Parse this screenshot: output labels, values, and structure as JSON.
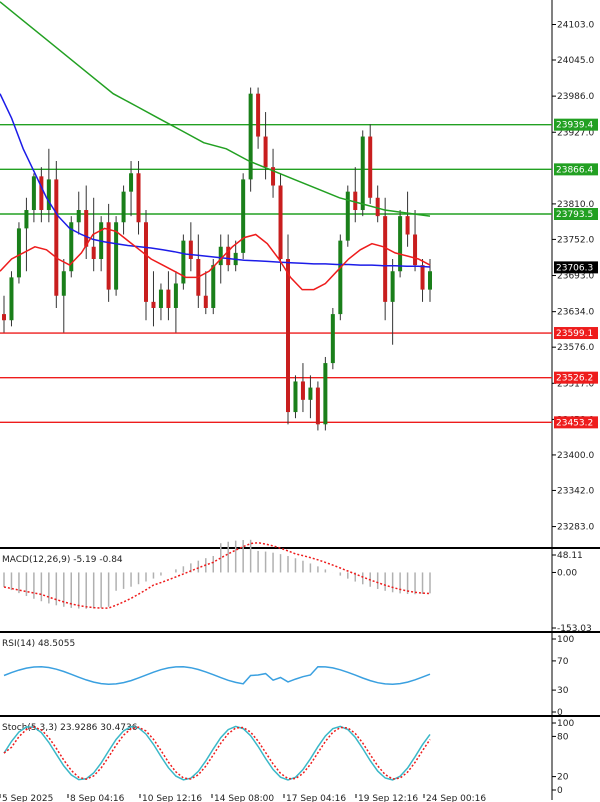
{
  "colors": {
    "up": "#1a7f1a",
    "down": "#c81e1e",
    "ma_fast": "#ee1c1c",
    "ma_mid": "#1c1ce8",
    "ma_slow": "#22a022",
    "resistance": "#22a022",
    "support": "#ee1c1c",
    "macd_hist": "#b0b0b0",
    "signal": "#ee1c1c",
    "rsi": "#3aa0e0",
    "stoch_main": "#3ab8c8",
    "stoch_signal": "#ee1c1c",
    "grid": "#cfcfcf",
    "price_tag": "#000000"
  },
  "chart_data": [
    {
      "type": "candlestick",
      "y_ticks": [
        "24103.0",
        "24045.0",
        "23986.0",
        "23927.0",
        "23810.0",
        "23752.0",
        "23693.0",
        "23634.0",
        "23576.0",
        "23517.0",
        "23458.0",
        "23400.0",
        "23342.0",
        "23283.0"
      ],
      "ylim": [
        23248,
        24143
      ],
      "last_price": "23706.3",
      "levels": [
        {
          "value": "23939.4",
          "kind": "resistance"
        },
        {
          "value": "23866.4",
          "kind": "resistance"
        },
        {
          "value": "23793.5",
          "kind": "resistance"
        },
        {
          "value": "23599.1",
          "kind": "support"
        },
        {
          "value": "23526.2",
          "kind": "support"
        },
        {
          "value": "23453.2",
          "kind": "support"
        }
      ],
      "x_labels": [
        "5 Sep 2025",
        "8 Sep 04:16",
        "10 Sep 12:16",
        "14 Sep 08:00",
        "17 Sep 04:16",
        "19 Sep 12:16",
        "24 Sep 00:16"
      ],
      "candles": [
        [
          23630,
          23660,
          23600,
          23620
        ],
        [
          23620,
          23700,
          23610,
          23690
        ],
        [
          23690,
          23780,
          23680,
          23770
        ],
        [
          23770,
          23820,
          23700,
          23800
        ],
        [
          23800,
          23860,
          23780,
          23855
        ],
        [
          23855,
          23870,
          23780,
          23800
        ],
        [
          23800,
          23900,
          23780,
          23850
        ],
        [
          23850,
          23880,
          23640,
          23660
        ],
        [
          23660,
          23720,
          23600,
          23700
        ],
        [
          23700,
          23790,
          23690,
          23780
        ],
        [
          23780,
          23830,
          23760,
          23800
        ],
        [
          23800,
          23840,
          23720,
          23740
        ],
        [
          23740,
          23820,
          23700,
          23720
        ],
        [
          23720,
          23790,
          23700,
          23780
        ],
        [
          23780,
          23810,
          23650,
          23670
        ],
        [
          23670,
          23790,
          23660,
          23780
        ],
        [
          23780,
          23840,
          23760,
          23830
        ],
        [
          23830,
          23880,
          23790,
          23860
        ],
        [
          23860,
          23880,
          23760,
          23780
        ],
        [
          23780,
          23800,
          23620,
          23650
        ],
        [
          23650,
          23700,
          23610,
          23640
        ],
        [
          23640,
          23680,
          23620,
          23670
        ],
        [
          23670,
          23700,
          23620,
          23640
        ],
        [
          23640,
          23700,
          23600,
          23680
        ],
        [
          23680,
          23760,
          23670,
          23750
        ],
        [
          23750,
          23780,
          23700,
          23720
        ],
        [
          23720,
          23760,
          23640,
          23660
        ],
        [
          23660,
          23700,
          23630,
          23640
        ],
        [
          23640,
          23720,
          23630,
          23710
        ],
        [
          23710,
          23760,
          23680,
          23740
        ],
        [
          23740,
          23760,
          23700,
          23710
        ],
        [
          23710,
          23750,
          23700,
          23730
        ],
        [
          23730,
          23860,
          23720,
          23850
        ],
        [
          23850,
          24000,
          23830,
          23990
        ],
        [
          23990,
          24000,
          23900,
          23920
        ],
        [
          23920,
          23960,
          23850,
          23870
        ],
        [
          23870,
          23900,
          23820,
          23840
        ],
        [
          23840,
          23860,
          23700,
          23720
        ],
        [
          23720,
          23760,
          23450,
          23470
        ],
        [
          23470,
          23530,
          23460,
          23520
        ],
        [
          23520,
          23550,
          23470,
          23490
        ],
        [
          23490,
          23530,
          23460,
          23510
        ],
        [
          23510,
          23520,
          23440,
          23450
        ],
        [
          23450,
          23560,
          23440,
          23550
        ],
        [
          23550,
          23640,
          23540,
          23630
        ],
        [
          23630,
          23760,
          23620,
          23750
        ],
        [
          23750,
          23840,
          23740,
          23830
        ],
        [
          23830,
          23870,
          23780,
          23800
        ],
        [
          23800,
          23930,
          23790,
          23920
        ],
        [
          23920,
          23940,
          23810,
          23820
        ],
        [
          23820,
          23840,
          23780,
          23790
        ],
        [
          23790,
          23820,
          23620,
          23650
        ],
        [
          23650,
          23720,
          23580,
          23700
        ],
        [
          23700,
          23800,
          23690,
          23790
        ],
        [
          23790,
          23830,
          23740,
          23760
        ],
        [
          23760,
          23800,
          23700,
          23710
        ],
        [
          23710,
          23720,
          23650,
          23670
        ],
        [
          23670,
          23720,
          23650,
          23700
        ]
      ],
      "ma_fast": [
        23700,
        23720,
        23730,
        23740,
        23735,
        23720,
        23710,
        23730,
        23760,
        23770,
        23765,
        23750,
        23735,
        23720,
        23710,
        23700,
        23690,
        23690,
        23700,
        23720,
        23740,
        23755,
        23760,
        23745,
        23720,
        23690,
        23670,
        23670,
        23680,
        23700,
        23720,
        23735,
        23745,
        23740,
        23730,
        23725,
        23720,
        23710
      ],
      "ma_mid": [
        23990,
        23950,
        23900,
        23860,
        23820,
        23790,
        23770,
        23760,
        23752,
        23748,
        23745,
        23742,
        23740,
        23738,
        23735,
        23732,
        23728,
        23726,
        23724,
        23722,
        23720,
        23718,
        23717,
        23716,
        23715,
        23714,
        23713,
        23712,
        23712,
        23711,
        23711,
        23710,
        23710,
        23709,
        23709,
        23708,
        23708,
        23707
      ],
      "ma_slow": [
        24140,
        24110,
        24080,
        24050,
        24020,
        23990,
        23970,
        23950,
        23930,
        23910,
        23900,
        23880,
        23865,
        23850,
        23835,
        23820,
        23810,
        23800,
        23795,
        23790
      ],
      "indicators": [
        {
          "label": "MACD(12,26,9) -5.19 -0.84",
          "y_ticks": [
            "48.11",
            "0.00",
            "-153.03"
          ],
          "ylim": [
            -153.03,
            48.11
          ]
        },
        {
          "label": "RSI(14) 48.5055",
          "y_ticks": [
            "100",
            "70",
            "30",
            "0"
          ],
          "ylim": [
            0,
            100
          ]
        },
        {
          "label": "Stoch(5,3,3) 23.9286 30.4736",
          "y_ticks": [
            "100",
            "80",
            "20",
            "0"
          ],
          "ylim": [
            0,
            100
          ]
        }
      ]
    }
  ]
}
